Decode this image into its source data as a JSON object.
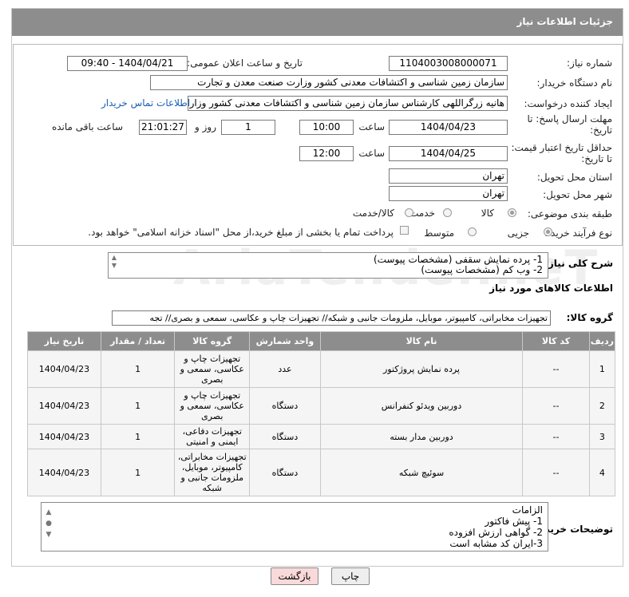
{
  "header": {
    "title": "جزئیات اطلاعات نیاز"
  },
  "labels": {
    "need_number": "شماره نیاز:",
    "announce_datetime": "تاریخ و ساعت اعلان عمومی:",
    "buyer_org": "نام دستگاه خریدار:",
    "requester": "ایجاد کننده درخواست:",
    "reply_deadline_line1": "مهلت ارسال پاسخ: تا",
    "reply_deadline_line2": "تاریخ:",
    "price_validity_line1": "حداقل تاریخ اعتبار قیمت:",
    "price_validity_line2": "تا تاریخ:",
    "time": "ساعت",
    "day_and": "روز و",
    "remaining": "ساعت باقی مانده",
    "province": "استان محل تحویل:",
    "city": "شهر محل تحویل:",
    "category": "طبقه بندی موضوعی:",
    "process_type": "نوع فرآیند خرید :",
    "description": "شرح کلی نیاز:",
    "goods_info": "اطلاعات کالاهای مورد نیاز",
    "goods_group": "گروه کالا:",
    "buyer_notes": "توضیحات خریدار:"
  },
  "values": {
    "need_number": "1104003008000071",
    "announce_datetime": "1404/04/21 - 09:40",
    "buyer_org": "سازمان زمین شناسی و اکتشافات معدنی کشور وزارت صنعت معدن و تجارت",
    "requester": "هانیه زرگراللهی کارشناس سازمان زمین شناسی و اکتشافات معدنی کشور وزارت",
    "contact_link": "اطلاعات تماس خریدار",
    "reply_date": "1404/04/23",
    "reply_time": "10:00",
    "reply_days": "1",
    "reply_remaining": "21:01:27",
    "price_date": "1404/04/25",
    "price_time": "12:00",
    "province": "تهران",
    "city": "تهران"
  },
  "category_options": [
    {
      "label": "کالا",
      "selected": true
    },
    {
      "label": "خدمت",
      "selected": false
    },
    {
      "label": "کالا/خدمت",
      "selected": false
    }
  ],
  "process_options": [
    {
      "label": "جزیی",
      "selected": true
    },
    {
      "label": "متوسط",
      "selected": false
    }
  ],
  "payment_note": "پرداخت تمام یا بخشی از مبلغ خرید،از محل \"اسناد خزانه اسلامی\" خواهد بود.",
  "description_lines": [
    "1- پرده نمایش سقفی (مشخصات پیوست)",
    "2- وب کم (مشخصات پیوست)"
  ],
  "goods_group_value": "تجهیزات مخابراتی، کامپیوتر، موبایل، ملزومات جانبی و شبکه// تجهیزات چاپ و عکاسی، سمعی و بصری// تجه",
  "table": {
    "headers": [
      "ردیف",
      "کد کالا",
      "نام کالا",
      "واحد شمارش",
      "گروه کالا",
      "تعداد / مقدار",
      "تاریخ نیاز"
    ],
    "rows": [
      {
        "row": "1",
        "code": "--",
        "name": "پرده نمایش پروژکتور",
        "unit": "عدد",
        "group": "تجهیزات چاپ و عکاسی، سمعی و بصری",
        "qty": "1",
        "date": "1404/04/23"
      },
      {
        "row": "2",
        "code": "--",
        "name": "دوربین ویدئو کنفرانس",
        "unit": "دستگاه",
        "group": "تجهیزات چاپ و عکاسی، سمعی و بصری",
        "qty": "1",
        "date": "1404/04/23"
      },
      {
        "row": "3",
        "code": "--",
        "name": "دوربین مدار بسته",
        "unit": "دستگاه",
        "group": "تجهیزات دفاعی، ایمنی و امنیتی",
        "qty": "1",
        "date": "1404/04/23"
      },
      {
        "row": "4",
        "code": "--",
        "name": "سوئیچ شبکه",
        "unit": "دستگاه",
        "group": "تجهیزات مخابراتی، کامپیوتر، موبایل، ملزومات جانبی و شبکه",
        "qty": "1",
        "date": "1404/04/23"
      }
    ]
  },
  "notes_lines": [
    "الزامات",
    "1-  پیش فاکتور",
    "2- گواهی ارزش افزوده",
    "3-ایران کد مشابه است"
  ],
  "buttons": {
    "print": "چاپ",
    "back": "بازگشت"
  },
  "watermark": "AriaTender.neT"
}
